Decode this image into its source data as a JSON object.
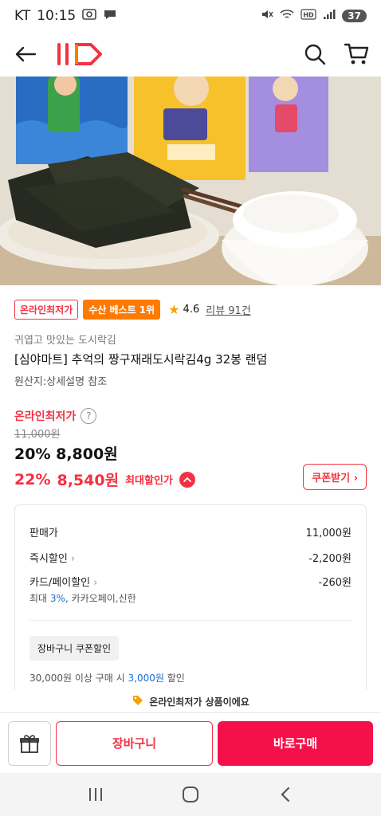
{
  "status": {
    "carrier": "KT",
    "time": "10:15",
    "battery": "37"
  },
  "colors": {
    "brand": "#f43142",
    "accent_orange": "#ff7a00",
    "link_blue": "#1a6dd8"
  },
  "product": {
    "badges": {
      "lowest": "온라인최저가",
      "best": "수산 베스트 1위"
    },
    "rating": "4.6",
    "review_link": "리뷰 91건",
    "subtitle": "귀엽고 맛있는 도시락김",
    "title": "[심야마트] 추억의 짱구재래도시락김4g 32봉 랜덤",
    "origin": "원산지:상세설명 참조"
  },
  "pricing": {
    "lowest_label": "온라인최저가",
    "original": "11,000원",
    "discount1_pct": "20%",
    "discount1_price": "8,800원",
    "discount2_pct": "22%",
    "discount2_price": "8,540원",
    "max_discount_label": "최대할인가",
    "coupon_button": "쿠폰받기"
  },
  "breakdown": {
    "sale_label": "판매가",
    "sale_value": "11,000원",
    "instant_label": "즉시할인",
    "instant_value": "-2,200원",
    "card_label": "카드/페이할인",
    "card_value": "-260원",
    "card_note_prefix": "최대 ",
    "card_note_pct": "3%",
    "card_note_suffix": ", 카카오페이,신한",
    "cart_coupon_tag": "장바구니 쿠폰할인",
    "cart_coupon_prefix": "30,000원 이상 구매 시 ",
    "cart_coupon_amount": "3,000원",
    "cart_coupon_suffix": " 할인"
  },
  "banner": {
    "text": "온라인최저가 상품이에요"
  },
  "actions": {
    "cart": "장바구니",
    "buy": "바로구매"
  }
}
